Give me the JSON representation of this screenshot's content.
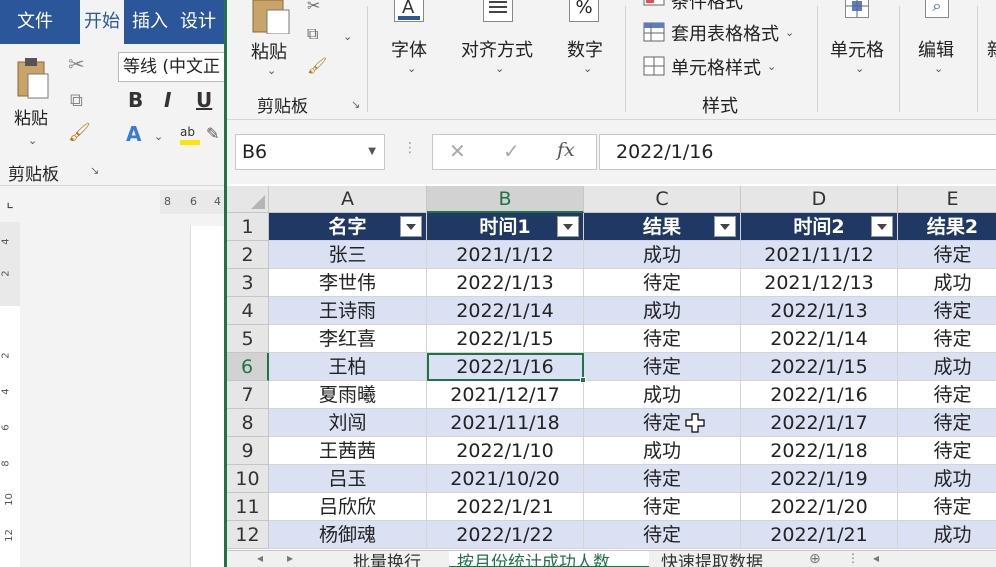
{
  "word": {
    "tabs": [
      {
        "label": "文件",
        "active": false
      },
      {
        "label": "开始",
        "active": true
      },
      {
        "label": "插入",
        "active": false
      },
      {
        "label": "设计",
        "active": false
      }
    ],
    "paste_label": "粘贴",
    "clipboard_group": "剪贴板",
    "font_name": "等线 (中文正",
    "format_buttons": [
      "B",
      "I",
      "U"
    ],
    "ruler_h_ticks": [
      "8",
      "6",
      "4"
    ],
    "ruler_v_ticks": [
      "4",
      "2",
      "2",
      "4",
      "6",
      "8",
      "10",
      "12"
    ]
  },
  "excel": {
    "ribbon": {
      "paste_label": "粘贴",
      "clipboard_group": "剪贴板",
      "font_label": "字体",
      "align_label": "对齐方式",
      "number_label": "数字",
      "conditional_format": "条件格式",
      "table_format": "套用表格格式",
      "cell_style": "单元格样式",
      "style_group": "样式",
      "cells_label": "单元格",
      "edit_label": "编辑",
      "new_label": "新"
    },
    "formula_bar": {
      "name_box": "B6",
      "fx": "fx",
      "value": "2022/1/16"
    },
    "columns": [
      "A",
      "B",
      "C",
      "D",
      "E"
    ],
    "selected_column": "B",
    "selected_row": "6",
    "headers": [
      "名字",
      "时间1",
      "结果",
      "时间2",
      "结果2"
    ],
    "rows": [
      {
        "num": "2",
        "cells": [
          "张三",
          "2021/1/12",
          "成功",
          "2021/11/12",
          "待定"
        ]
      },
      {
        "num": "3",
        "cells": [
          "李世伟",
          "2022/1/13",
          "待定",
          "2021/12/13",
          "成功"
        ]
      },
      {
        "num": "4",
        "cells": [
          "王诗雨",
          "2022/1/14",
          "成功",
          "2022/1/13",
          "待定"
        ]
      },
      {
        "num": "5",
        "cells": [
          "李红喜",
          "2022/1/15",
          "待定",
          "2022/1/14",
          "待定"
        ]
      },
      {
        "num": "6",
        "cells": [
          "王柏",
          "2022/1/16",
          "待定",
          "2022/1/15",
          "成功"
        ]
      },
      {
        "num": "7",
        "cells": [
          "夏雨曦",
          "2021/12/17",
          "成功",
          "2022/1/16",
          "待定"
        ]
      },
      {
        "num": "8",
        "cells": [
          "刘闯",
          "2021/11/18",
          "待定",
          "2022/1/17",
          "待定"
        ]
      },
      {
        "num": "9",
        "cells": [
          "王茜茜",
          "2022/1/10",
          "成功",
          "2022/1/18",
          "待定"
        ]
      },
      {
        "num": "10",
        "cells": [
          "吕玉",
          "2021/10/20",
          "待定",
          "2022/1/19",
          "成功"
        ]
      },
      {
        "num": "11",
        "cells": [
          "吕欣欣",
          "2022/1/21",
          "待定",
          "2022/1/20",
          "待定"
        ]
      },
      {
        "num": "12",
        "cells": [
          "杨御魂",
          "2022/1/22",
          "待定",
          "2022/1/21",
          "成功"
        ]
      }
    ],
    "header_row_num": "1",
    "sheet_tabs": [
      {
        "label": "批量换行",
        "active": false
      },
      {
        "label": "按月份统计成功人数",
        "active": true
      },
      {
        "label": "快速提取数据",
        "active": false
      }
    ],
    "colors": {
      "accent": "#217346",
      "header_fill": "#1f3864",
      "band_fill": "#d9e1f2"
    }
  }
}
